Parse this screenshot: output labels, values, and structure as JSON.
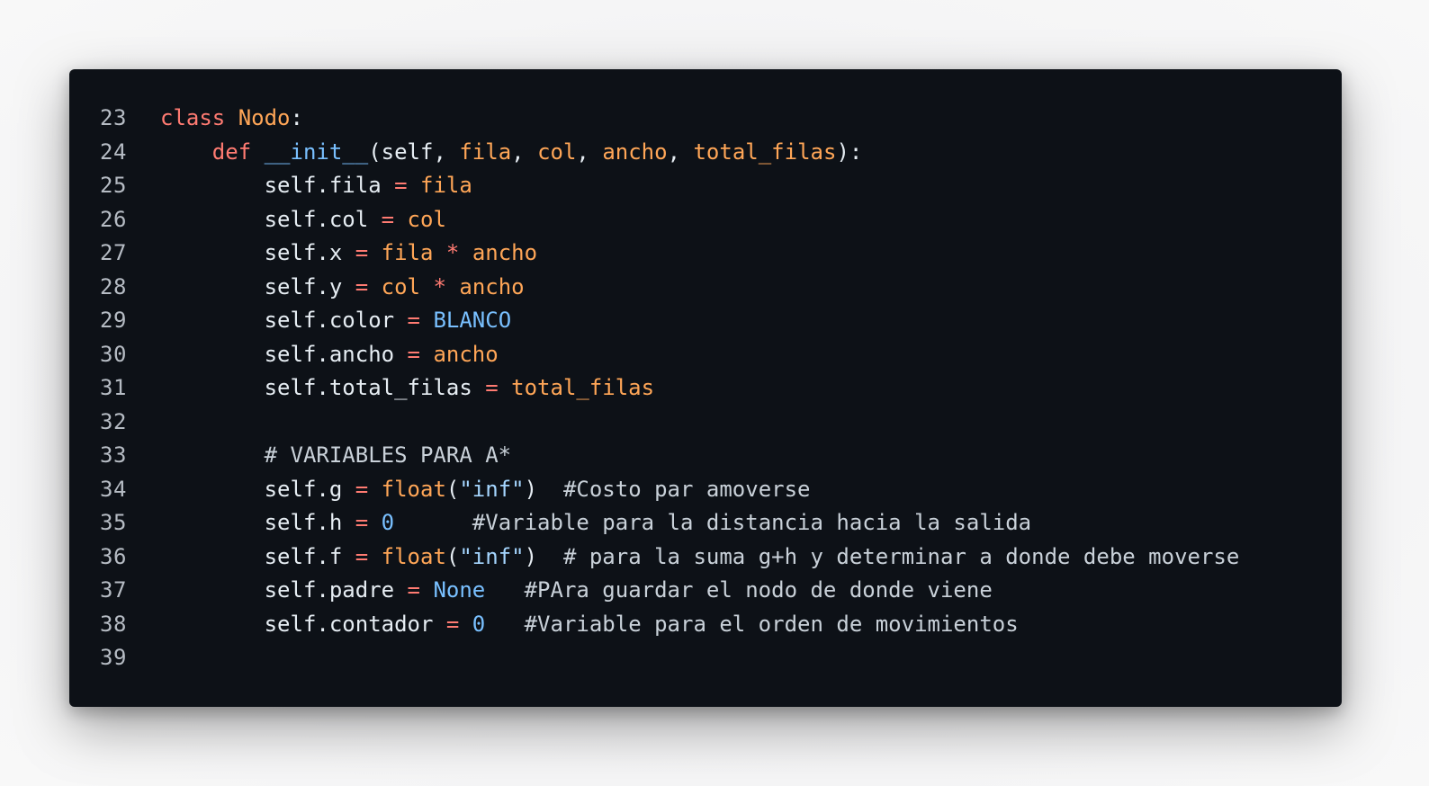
{
  "editor": {
    "background": "#0d1117",
    "lines": [
      {
        "number": "23",
        "tokens": [
          {
            "t": "kw",
            "v": "class"
          },
          {
            "t": "id",
            "v": " "
          },
          {
            "t": "cls",
            "v": "Nodo"
          },
          {
            "t": "punc",
            "v": ":"
          }
        ]
      },
      {
        "number": "24",
        "tokens": [
          {
            "t": "id",
            "v": "    "
          },
          {
            "t": "kw",
            "v": "def"
          },
          {
            "t": "id",
            "v": " "
          },
          {
            "t": "fn",
            "v": "__init__"
          },
          {
            "t": "punc",
            "v": "(self, "
          },
          {
            "t": "arg",
            "v": "fila"
          },
          {
            "t": "punc",
            "v": ", "
          },
          {
            "t": "arg",
            "v": "col"
          },
          {
            "t": "punc",
            "v": ", "
          },
          {
            "t": "arg",
            "v": "ancho"
          },
          {
            "t": "punc",
            "v": ", "
          },
          {
            "t": "arg",
            "v": "total_filas"
          },
          {
            "t": "punc",
            "v": "):"
          }
        ]
      },
      {
        "number": "25",
        "tokens": [
          {
            "t": "id",
            "v": "        self.fila "
          },
          {
            "t": "op",
            "v": "="
          },
          {
            "t": "id",
            "v": " "
          },
          {
            "t": "arg",
            "v": "fila"
          }
        ]
      },
      {
        "number": "26",
        "tokens": [
          {
            "t": "id",
            "v": "        self.col "
          },
          {
            "t": "op",
            "v": "="
          },
          {
            "t": "id",
            "v": " "
          },
          {
            "t": "arg",
            "v": "col"
          }
        ]
      },
      {
        "number": "27",
        "tokens": [
          {
            "t": "id",
            "v": "        self.x "
          },
          {
            "t": "op",
            "v": "="
          },
          {
            "t": "id",
            "v": " "
          },
          {
            "t": "arg",
            "v": "fila"
          },
          {
            "t": "id",
            "v": " "
          },
          {
            "t": "op",
            "v": "*"
          },
          {
            "t": "id",
            "v": " "
          },
          {
            "t": "arg",
            "v": "ancho"
          }
        ]
      },
      {
        "number": "28",
        "tokens": [
          {
            "t": "id",
            "v": "        self.y "
          },
          {
            "t": "op",
            "v": "="
          },
          {
            "t": "id",
            "v": " "
          },
          {
            "t": "arg",
            "v": "col"
          },
          {
            "t": "id",
            "v": " "
          },
          {
            "t": "op",
            "v": "*"
          },
          {
            "t": "id",
            "v": " "
          },
          {
            "t": "arg",
            "v": "ancho"
          }
        ]
      },
      {
        "number": "29",
        "tokens": [
          {
            "t": "id",
            "v": "        self.color "
          },
          {
            "t": "op",
            "v": "="
          },
          {
            "t": "id",
            "v": " "
          },
          {
            "t": "const",
            "v": "BLANCO"
          }
        ]
      },
      {
        "number": "30",
        "tokens": [
          {
            "t": "id",
            "v": "        self.ancho "
          },
          {
            "t": "op",
            "v": "="
          },
          {
            "t": "id",
            "v": " "
          },
          {
            "t": "arg",
            "v": "ancho"
          }
        ]
      },
      {
        "number": "31",
        "tokens": [
          {
            "t": "id",
            "v": "        self.total_filas "
          },
          {
            "t": "op",
            "v": "="
          },
          {
            "t": "id",
            "v": " "
          },
          {
            "t": "arg",
            "v": "total_filas"
          }
        ]
      },
      {
        "number": "32",
        "tokens": []
      },
      {
        "number": "33",
        "tokens": [
          {
            "t": "cmt",
            "v": "        # VARIABLES PARA A*"
          }
        ]
      },
      {
        "number": "34",
        "tokens": [
          {
            "t": "id",
            "v": "        self.g "
          },
          {
            "t": "op",
            "v": "="
          },
          {
            "t": "id",
            "v": " "
          },
          {
            "t": "builtin",
            "v": "float"
          },
          {
            "t": "punc",
            "v": "("
          },
          {
            "t": "str",
            "v": "\"inf\""
          },
          {
            "t": "punc",
            "v": ")"
          },
          {
            "t": "cmt",
            "v": "  #Costo par amoverse"
          }
        ]
      },
      {
        "number": "35",
        "tokens": [
          {
            "t": "id",
            "v": "        self.h "
          },
          {
            "t": "op",
            "v": "="
          },
          {
            "t": "id",
            "v": " "
          },
          {
            "t": "num",
            "v": "0"
          },
          {
            "t": "cmt",
            "v": "      #Variable para la distancia hacia la salida"
          }
        ]
      },
      {
        "number": "36",
        "tokens": [
          {
            "t": "id",
            "v": "        self.f "
          },
          {
            "t": "op",
            "v": "="
          },
          {
            "t": "id",
            "v": " "
          },
          {
            "t": "builtin",
            "v": "float"
          },
          {
            "t": "punc",
            "v": "("
          },
          {
            "t": "str",
            "v": "\"inf\""
          },
          {
            "t": "punc",
            "v": ")"
          },
          {
            "t": "cmt",
            "v": "  # para la suma g+h y determinar a donde debe moverse"
          }
        ]
      },
      {
        "number": "37",
        "tokens": [
          {
            "t": "id",
            "v": "        self.padre "
          },
          {
            "t": "op",
            "v": "="
          },
          {
            "t": "id",
            "v": " "
          },
          {
            "t": "const",
            "v": "None"
          },
          {
            "t": "cmt",
            "v": "   #PAra guardar el nodo de donde viene"
          }
        ]
      },
      {
        "number": "38",
        "tokens": [
          {
            "t": "id",
            "v": "        self.contador "
          },
          {
            "t": "op",
            "v": "="
          },
          {
            "t": "id",
            "v": " "
          },
          {
            "t": "num",
            "v": "0"
          },
          {
            "t": "cmt",
            "v": "   #Variable para el orden de movimientos"
          }
        ]
      },
      {
        "number": "39",
        "tokens": []
      }
    ]
  }
}
